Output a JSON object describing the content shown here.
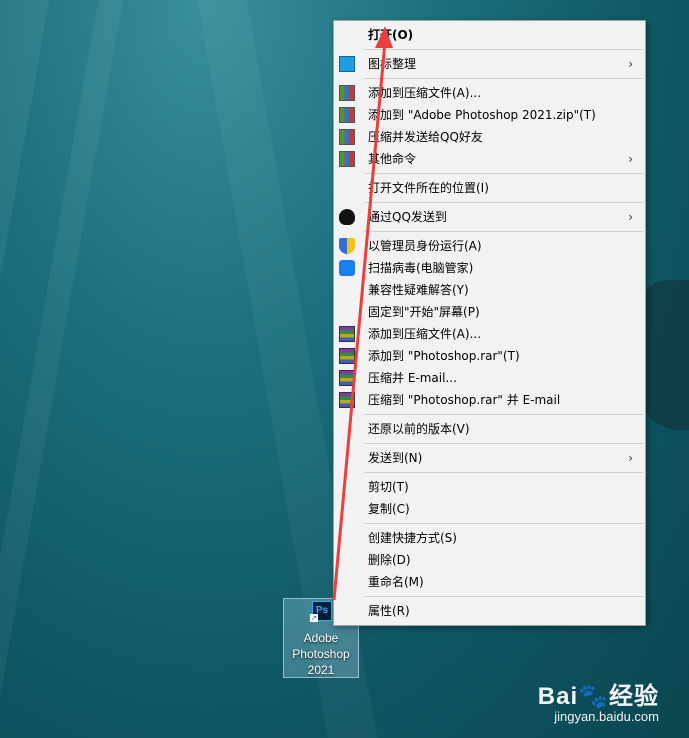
{
  "desktop": {
    "icon_label": "Adobe\nPhotoshop\n2021",
    "icon_badge": "Ps",
    "shortcut_glyph": "↗"
  },
  "menu": {
    "items": [
      {
        "label": "打开(O)",
        "icon": "",
        "bold": true,
        "submenu": false
      },
      {
        "label": "图标整理",
        "icon": "desktop-icon",
        "submenu": true
      },
      {
        "label": "添加到压缩文件(A)...",
        "icon": "zip-icon",
        "submenu": false
      },
      {
        "label": "添加到 \"Adobe Photoshop 2021.zip\"(T)",
        "icon": "zip-icon",
        "submenu": false
      },
      {
        "label": "压缩并发送给QQ好友",
        "icon": "zip-icon",
        "submenu": false
      },
      {
        "label": "其他命令",
        "icon": "zip-icon",
        "submenu": true
      },
      {
        "label": "打开文件所在的位置(I)",
        "icon": "",
        "submenu": false
      },
      {
        "label": "通过QQ发送到",
        "icon": "qq-penguin-icon",
        "submenu": true
      },
      {
        "label": "以管理员身份运行(A)",
        "icon": "uac-shield-icon",
        "submenu": false
      },
      {
        "label": "扫描病毒(电脑管家)",
        "icon": "pc-manager-icon",
        "submenu": false
      },
      {
        "label": "兼容性疑难解答(Y)",
        "icon": "",
        "submenu": false
      },
      {
        "label": "固定到\"开始\"屏幕(P)",
        "icon": "",
        "submenu": false
      },
      {
        "label": "添加到压缩文件(A)...",
        "icon": "winrar-icon",
        "submenu": false
      },
      {
        "label": "添加到 \"Photoshop.rar\"(T)",
        "icon": "winrar-icon",
        "submenu": false
      },
      {
        "label": "压缩并 E-mail...",
        "icon": "winrar-icon",
        "submenu": false
      },
      {
        "label": "压缩到 \"Photoshop.rar\" 并 E-mail",
        "icon": "winrar-icon",
        "submenu": false
      },
      {
        "label": "还原以前的版本(V)",
        "icon": "",
        "submenu": false
      },
      {
        "label": "发送到(N)",
        "icon": "",
        "submenu": true
      },
      {
        "label": "剪切(T)",
        "icon": "",
        "submenu": false
      },
      {
        "label": "复制(C)",
        "icon": "",
        "submenu": false
      },
      {
        "label": "创建快捷方式(S)",
        "icon": "",
        "submenu": false
      },
      {
        "label": "删除(D)",
        "icon": "",
        "submenu": false
      },
      {
        "label": "重命名(M)",
        "icon": "",
        "submenu": false
      },
      {
        "label": "属性(R)",
        "icon": "",
        "submenu": false
      }
    ],
    "chevron": "›"
  },
  "annotation": {
    "color": "#e8403c"
  },
  "watermark": {
    "logo": "Bai🐾经验",
    "url": "jingyan.baidu.com"
  }
}
